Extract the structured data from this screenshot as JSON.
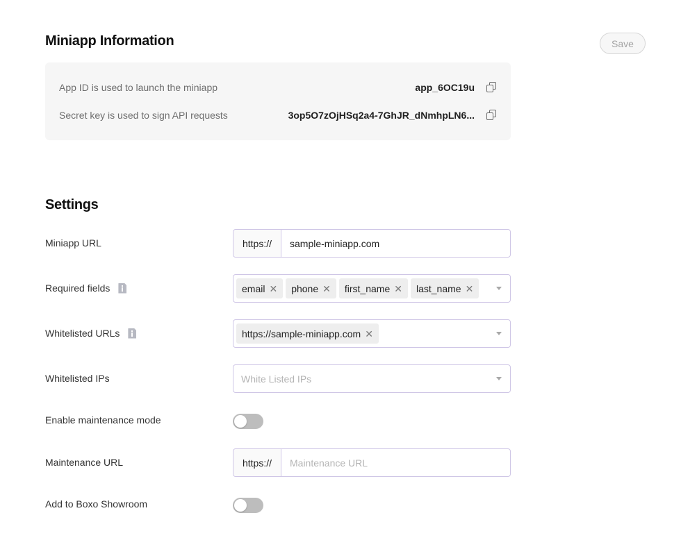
{
  "info": {
    "title": "Miniapp Information",
    "save_label": "Save",
    "app_id": {
      "label": "App ID is used to launch the miniapp",
      "value": "app_6OC19u"
    },
    "secret": {
      "label": "Secret key is used to sign API requests",
      "value": "3op5O7zOjHSq2a4-7GhJR_dNmhpLN6..."
    }
  },
  "settings": {
    "title": "Settings",
    "miniapp_url": {
      "label": "Miniapp URL",
      "prefix": "https://",
      "value": "sample-miniapp.com"
    },
    "required_fields": {
      "label": "Required fields",
      "tags": [
        "email",
        "phone",
        "first_name",
        "last_name"
      ]
    },
    "whitelisted_urls": {
      "label": "Whitelisted URLs",
      "tags": [
        "https://sample-miniapp.com"
      ]
    },
    "whitelisted_ips": {
      "label": "Whitelisted IPs",
      "placeholder": "White Listed IPs"
    },
    "maintenance_mode": {
      "label": "Enable maintenance mode",
      "enabled": false
    },
    "maintenance_url": {
      "label": "Maintenance URL",
      "prefix": "https://",
      "placeholder": "Maintenance URL",
      "value": ""
    },
    "showroom": {
      "label": "Add to Boxo Showroom",
      "enabled": false
    }
  },
  "icons": {
    "copy": "copy-icon",
    "info": "info-doc-icon",
    "remove": "close-icon",
    "dropdown": "chevron-down-icon"
  },
  "colors": {
    "field_border": "#cfc6e6",
    "toggle_off": "#bdbdbd",
    "info_bg": "#f6f6f6"
  }
}
